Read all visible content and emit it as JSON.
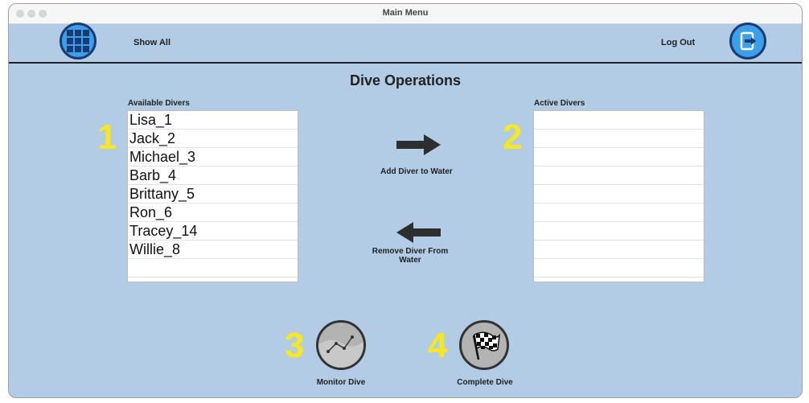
{
  "window": {
    "title": "Main Menu"
  },
  "header": {
    "show_all_label": "Show All",
    "logout_label": "Log Out"
  },
  "main": {
    "title": "Dive Operations",
    "available": {
      "label": "Available Divers",
      "number": "1",
      "items": [
        "Lisa_1",
        "Jack_2",
        "Michael_3",
        "Barb_4",
        "Brittany_5",
        "Ron_6",
        "Tracey_14",
        "Willie_8"
      ]
    },
    "active": {
      "label": "Active Divers",
      "number": "2",
      "items": []
    },
    "add_label": "Add Diver to Water",
    "remove_label": "Remove Diver From Water"
  },
  "footer": {
    "monitor": {
      "number": "3",
      "label": "Monitor Dive"
    },
    "complete": {
      "number": "4",
      "label": "Complete Dive"
    }
  },
  "colors": {
    "background": "#b1cce4",
    "button_blue": "#3aa0ec",
    "number_yellow": "#f6e81a"
  },
  "icons": [
    "grid-icon",
    "logout-icon",
    "arrow-right-icon",
    "arrow-left-icon",
    "chart-icon",
    "checkered-flag-icon"
  ]
}
